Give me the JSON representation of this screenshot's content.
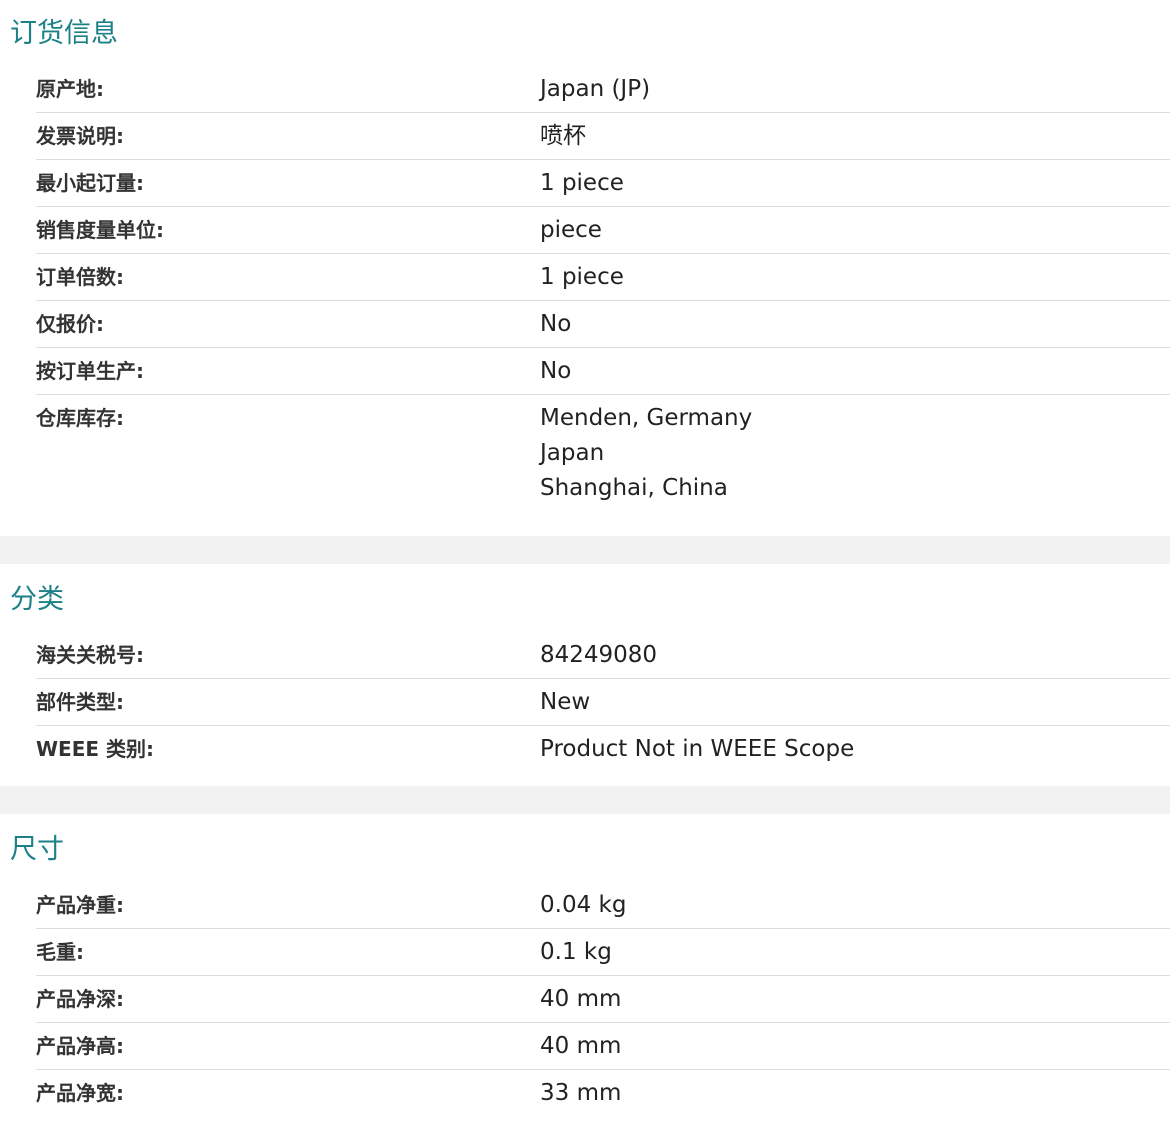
{
  "sections": [
    {
      "title": "订货信息",
      "rows": [
        {
          "label": "原产地:",
          "values": [
            "Japan (JP)"
          ]
        },
        {
          "label": "发票说明:",
          "values": [
            "喷杯"
          ]
        },
        {
          "label": "最小起订量:",
          "values": [
            "1 piece"
          ]
        },
        {
          "label": "销售度量单位:",
          "values": [
            "piece"
          ]
        },
        {
          "label": "订单倍数:",
          "values": [
            "1 piece"
          ]
        },
        {
          "label": "仅报价:",
          "values": [
            "No"
          ]
        },
        {
          "label": "按订单生产:",
          "values": [
            "No"
          ]
        },
        {
          "label": "仓库库存:",
          "values": [
            "Menden, Germany",
            "Japan",
            "Shanghai, China"
          ]
        }
      ]
    },
    {
      "title": "分类",
      "rows": [
        {
          "label": "海关关税号:",
          "values": [
            "84249080"
          ]
        },
        {
          "label": "部件类型:",
          "values": [
            "New"
          ]
        },
        {
          "label": "WEEE 类别:",
          "values": [
            "Product Not in WEEE Scope"
          ]
        }
      ]
    },
    {
      "title": "尺寸",
      "rows": [
        {
          "label": "产品净重:",
          "values": [
            "0.04 kg"
          ]
        },
        {
          "label": "毛重:",
          "values": [
            "0.1 kg"
          ]
        },
        {
          "label": "产品净深:",
          "values": [
            "40 mm"
          ]
        },
        {
          "label": "产品净高:",
          "values": [
            "40 mm"
          ]
        },
        {
          "label": "产品净宽:",
          "values": [
            "33 mm"
          ]
        }
      ]
    }
  ]
}
